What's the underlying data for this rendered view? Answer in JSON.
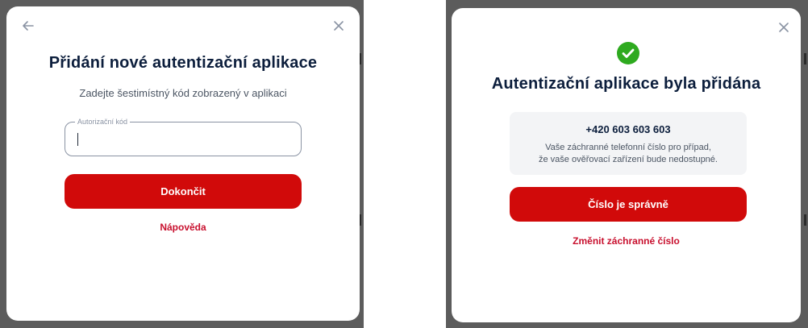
{
  "colors": {
    "brand_red": "#d10a0a",
    "link_red": "#c8102e",
    "title_navy": "#0c1e3c",
    "success_green": "#2eaa1f",
    "backdrop": "#5c5c5c"
  },
  "left_dialog": {
    "back_icon": "arrow-left-icon",
    "close_icon": "close-icon",
    "title": "Přidání nové autentizační aplikace",
    "subtitle": "Zadejte šestimístný kód zobrazený v aplikaci",
    "code_field": {
      "label": "Autorizační kód",
      "value": ""
    },
    "submit_label": "Dokončit",
    "help_link": "Nápověda"
  },
  "right_dialog": {
    "close_icon": "close-icon",
    "status_icon": "check-circle-icon",
    "title": "Autentizační aplikace byla přidána",
    "phone_number": "+420 603 603 603",
    "info_line_1": "Vaše záchranné telefonní číslo pro případ,",
    "info_line_2": "že vaše ověřovací zařízení bude nedostupné.",
    "confirm_label": "Číslo je správně",
    "change_link": "Změnit záchranné číslo"
  }
}
